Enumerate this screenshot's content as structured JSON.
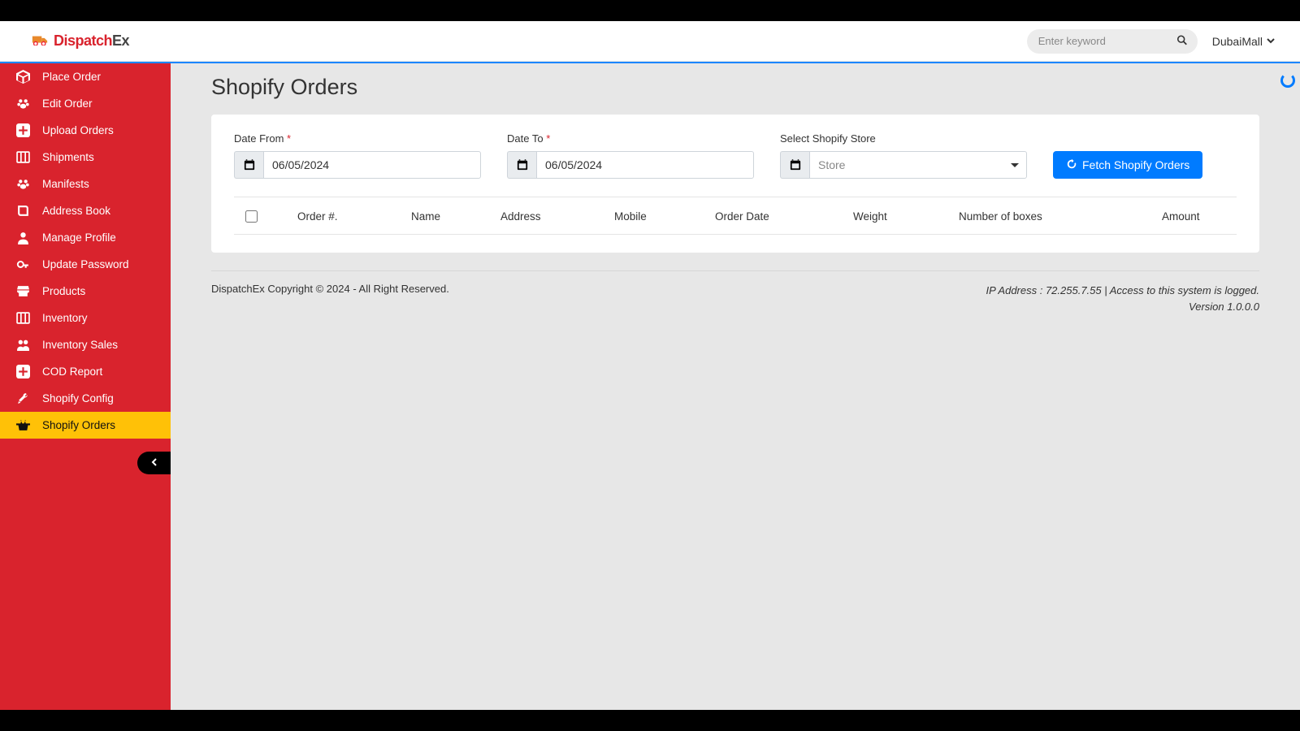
{
  "brand": {
    "left": "Dispatch",
    "right": "Ex"
  },
  "search": {
    "placeholder": "Enter keyword"
  },
  "user": {
    "name": "DubaiMall"
  },
  "sidebar": {
    "items": [
      {
        "label": "Place Order",
        "icon": "cube"
      },
      {
        "label": "Edit Order",
        "icon": "paw"
      },
      {
        "label": "Upload Orders",
        "icon": "plus"
      },
      {
        "label": "Shipments",
        "icon": "columns"
      },
      {
        "label": "Manifests",
        "icon": "paw"
      },
      {
        "label": "Address Book",
        "icon": "book"
      },
      {
        "label": "Manage Profile",
        "icon": "user"
      },
      {
        "label": "Update Password",
        "icon": "key"
      },
      {
        "label": "Products",
        "icon": "store"
      },
      {
        "label": "Inventory",
        "icon": "columns"
      },
      {
        "label": "Inventory Sales",
        "icon": "users"
      },
      {
        "label": "COD Report",
        "icon": "plus"
      },
      {
        "label": "Shopify Config",
        "icon": "tools"
      },
      {
        "label": "Shopify Orders",
        "icon": "basket",
        "active": true
      }
    ]
  },
  "page": {
    "title": "Shopify Orders"
  },
  "filters": {
    "date_from_label": "Date From",
    "date_to_label": "Date To",
    "store_label": "Select Shopify Store",
    "date_from_value": "06/05/2024",
    "date_to_value": "06/05/2024",
    "store_placeholder": "Store",
    "fetch_label": "Fetch Shopify Orders"
  },
  "table": {
    "headers": {
      "order": "Order #.",
      "name": "Name",
      "address": "Address",
      "mobile": "Mobile",
      "order_date": "Order Date",
      "weight": "Weight",
      "boxes": "Number of boxes",
      "amount": "Amount"
    }
  },
  "footer": {
    "copyright": "DispatchEx Copyright © 2024 - All Right Reserved.",
    "ip_line": "IP Address : 72.255.7.55 | Access to this system is logged.",
    "version": "Version 1.0.0.0"
  }
}
